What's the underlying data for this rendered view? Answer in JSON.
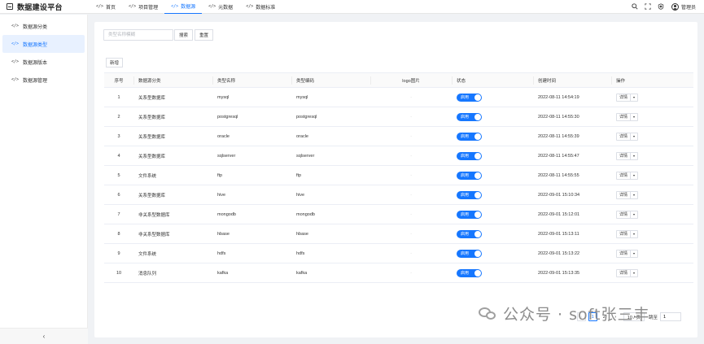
{
  "app": {
    "title": "数据建设平台",
    "user": "管理员",
    "icons": [
      "search-icon",
      "fullscreen-icon",
      "theme-icon",
      "user-icon"
    ]
  },
  "nav": [
    {
      "label": "首页",
      "active": false
    },
    {
      "label": "项目管理",
      "active": false
    },
    {
      "label": "数据源",
      "active": true
    },
    {
      "label": "元数据",
      "active": false
    },
    {
      "label": "数据标准",
      "active": false
    }
  ],
  "sidebar": {
    "items": [
      {
        "label": "数据源分类",
        "active": false
      },
      {
        "label": "数据源类型",
        "active": true
      },
      {
        "label": "数据源版本",
        "active": false
      },
      {
        "label": "数据源管理",
        "active": false
      }
    ],
    "collapse": "‹"
  },
  "search": {
    "placeholder": "类型名称模糊",
    "value": "",
    "search_label": "搜索",
    "reset_label": "重置"
  },
  "add_label": "新增",
  "table": {
    "headers": [
      "序号",
      "数据源分类",
      "类型名称",
      "类型编码",
      "logo图片",
      "状态",
      "创建时间",
      "操作"
    ],
    "rows": [
      {
        "idx": "1",
        "category": "关系型数据库",
        "name": "mysql",
        "code": "mysql",
        "logo": "·",
        "status": "启用",
        "created": "2022-08-11 14:54:19",
        "op": "详情"
      },
      {
        "idx": "2",
        "category": "关系型数据库",
        "name": "postgresql",
        "code": "postgresql",
        "logo": "·",
        "status": "启用",
        "created": "2022-08-11 14:55:30",
        "op": "详情"
      },
      {
        "idx": "3",
        "category": "关系型数据库",
        "name": "oracle",
        "code": "oracle",
        "logo": "·",
        "status": "启用",
        "created": "2022-08-11 14:55:39",
        "op": "详情"
      },
      {
        "idx": "4",
        "category": "关系型数据库",
        "name": "sqlserver",
        "code": "sqlserver",
        "logo": "·",
        "status": "启用",
        "created": "2022-08-11 14:55:47",
        "op": "详情"
      },
      {
        "idx": "5",
        "category": "文件系统",
        "name": "ftp",
        "code": "ftp",
        "logo": "·",
        "status": "启用",
        "created": "2022-08-11 14:55:55",
        "op": "详情"
      },
      {
        "idx": "6",
        "category": "关系型数据库",
        "name": "hive",
        "code": "hive",
        "logo": "·",
        "status": "启用",
        "created": "2022-09-01 15:10:34",
        "op": "详情"
      },
      {
        "idx": "7",
        "category": "非关系型数据库",
        "name": "mongodb",
        "code": "mongodb",
        "logo": "·",
        "status": "启用",
        "created": "2022-09-01 15:12:01",
        "op": "详情"
      },
      {
        "idx": "8",
        "category": "非关系型数据库",
        "name": "hbase",
        "code": "hbase",
        "logo": "·",
        "status": "启用",
        "created": "2022-09-01 15:13:11",
        "op": "详情"
      },
      {
        "idx": "9",
        "category": "文件系统",
        "name": "hdfs",
        "code": "hdfs",
        "logo": "·",
        "status": "启用",
        "created": "2022-09-01 15:13:22",
        "op": "详情"
      },
      {
        "idx": "10",
        "category": "消息队列",
        "name": "kafka",
        "code": "kafka",
        "logo": "·",
        "status": "启用",
        "created": "2022-09-01 15:13:35",
        "op": "详情"
      }
    ]
  },
  "pagination": {
    "prev": "‹",
    "pages": [
      "1",
      "2"
    ],
    "current": "1",
    "next": "›",
    "page_size": "10 / 页",
    "jump_label": "跳至",
    "jump_value": "1"
  },
  "watermark": "公众号 · soft张三丰",
  "colors": {
    "accent": "#1677ff",
    "active_bg": "#e8f1ff"
  }
}
